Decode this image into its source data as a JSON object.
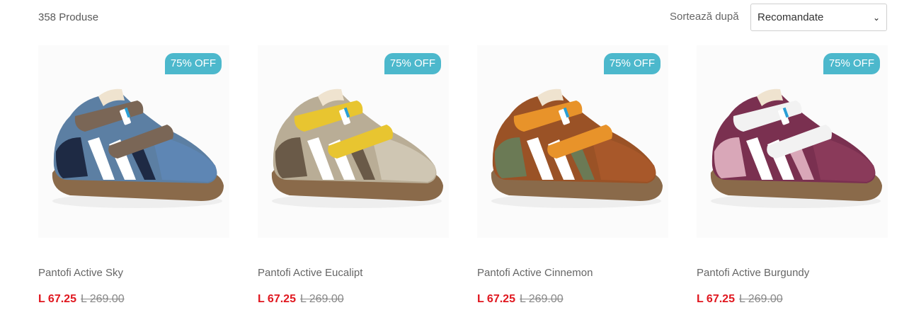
{
  "toolbar": {
    "count_text": "358 Produse",
    "sort_label": "Sortează după",
    "sort_selected": "Recomandate"
  },
  "products": [
    {
      "name": "Pantofi Active Sky",
      "badge": "75% OFF",
      "price": "L 67.25",
      "old_price": "L 269.00",
      "colors": {
        "main": "#5c7fa3",
        "dark": "#1e2a44",
        "strap": "#7a6656",
        "toe": "#5e86b4",
        "sole": "#8a6a4a"
      }
    },
    {
      "name": "Pantofi Active Eucalipt",
      "badge": "75% OFF",
      "price": "L 67.25",
      "old_price": "L 269.00",
      "colors": {
        "main": "#b9ad96",
        "dark": "#6a5a48",
        "strap": "#e8c530",
        "toe": "#cfc6b3",
        "sole": "#8a6a4a"
      }
    },
    {
      "name": "Pantofi Active Cinnemon",
      "badge": "75% OFF",
      "price": "L 67.25",
      "old_price": "L 269.00",
      "colors": {
        "main": "#9a5226",
        "dark": "#6b7a55",
        "strap": "#e8932a",
        "toe": "#a8582a",
        "sole": "#8a6a4a"
      }
    },
    {
      "name": "Pantofi Active Burgundy",
      "badge": "75% OFF",
      "price": "L 67.25",
      "old_price": "L 269.00",
      "colors": {
        "main": "#7a3050",
        "dark": "#d9a7b8",
        "strap": "#f2f2f2",
        "toe": "#8a3a5a",
        "sole": "#8a6a4a"
      }
    }
  ]
}
